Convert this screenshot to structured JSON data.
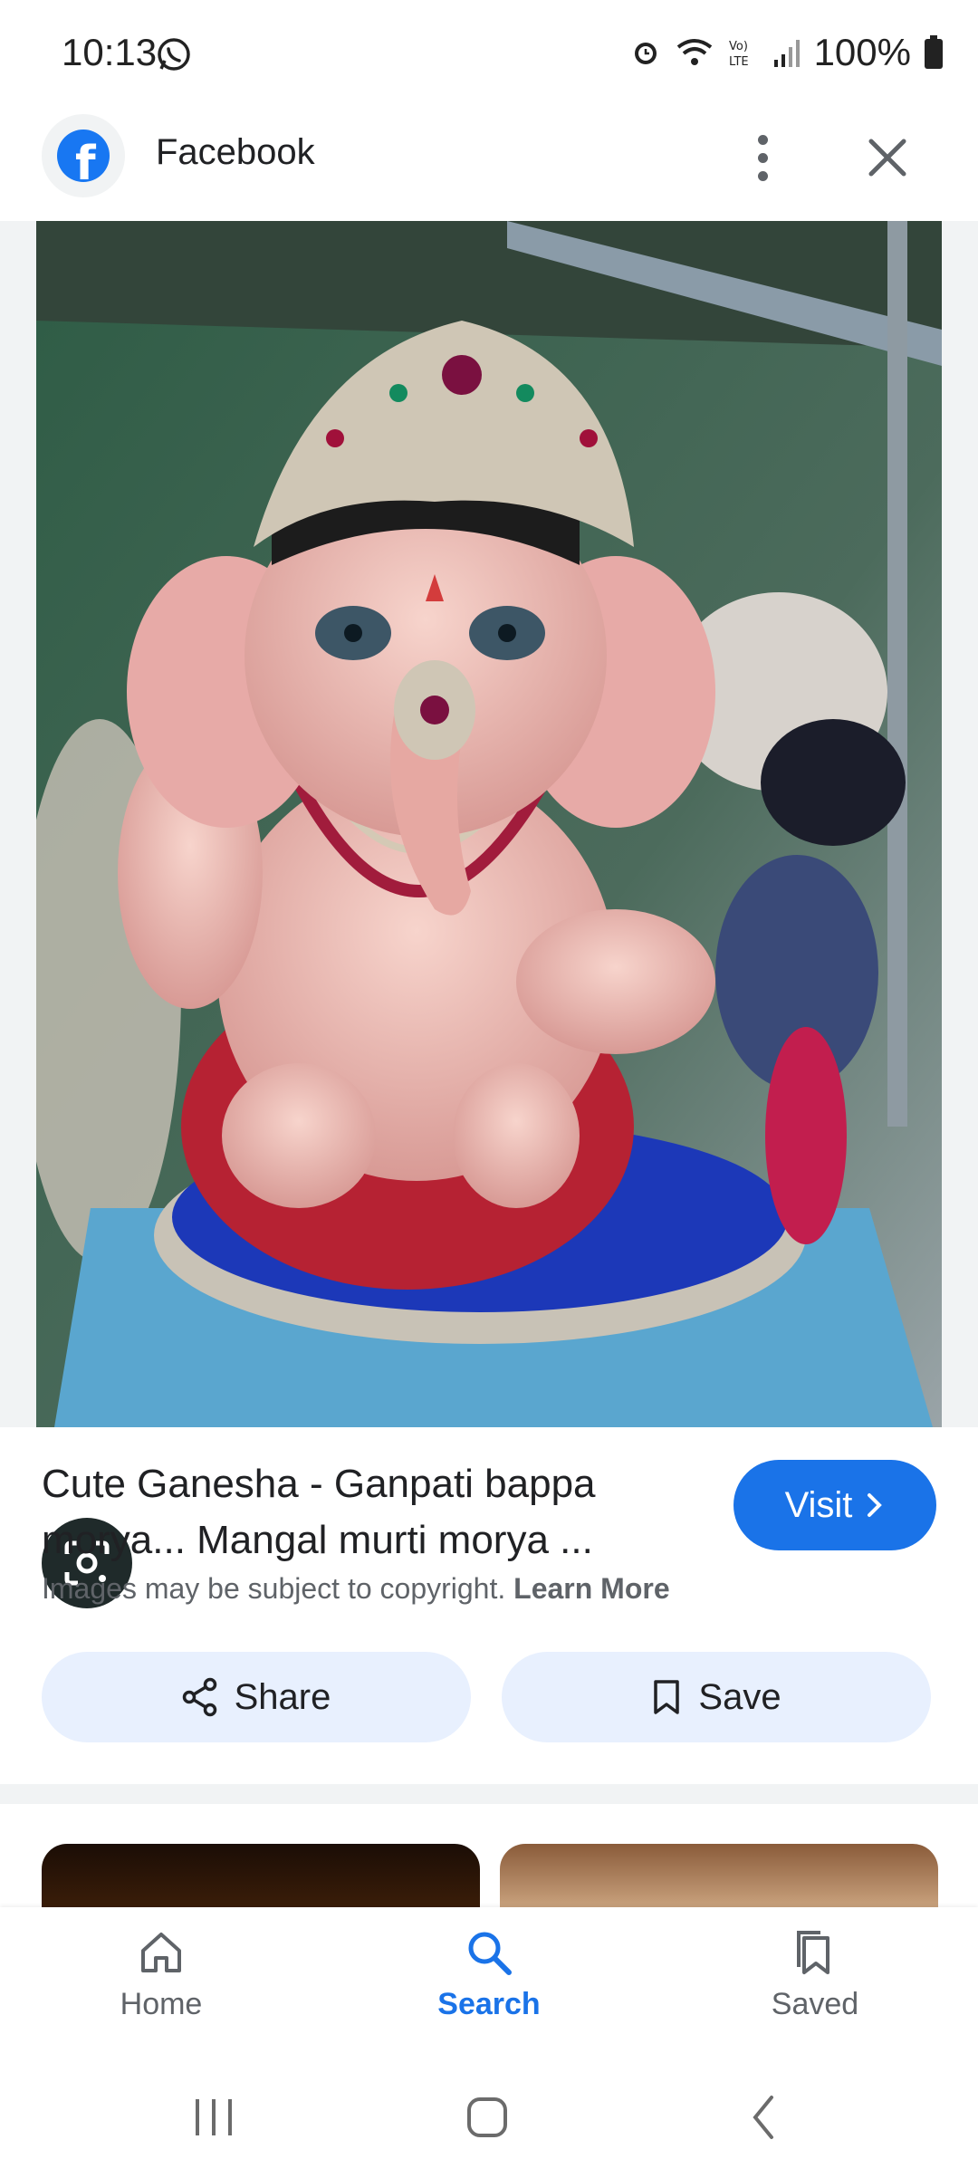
{
  "status_bar": {
    "time": "10:13",
    "battery": "100%"
  },
  "header": {
    "site_name": "Facebook"
  },
  "result": {
    "title": "Cute Ganesha - Ganpati bappa morya... Mangal murti morya ...",
    "visit_label": "Visit",
    "copyright_text": "Images may be subject to copyright.",
    "learn_more": "Learn More",
    "share_label": "Share",
    "save_label": "Save"
  },
  "bottom_nav": {
    "items": [
      {
        "label": "Home",
        "icon": "home-icon"
      },
      {
        "label": "Search",
        "icon": "search-icon"
      },
      {
        "label": "Saved",
        "icon": "saved-icon"
      }
    ],
    "active": "Search"
  },
  "colors": {
    "accent": "#1a73e8",
    "chip_bg": "#e8f0fe",
    "facebook": "#1877f2"
  }
}
